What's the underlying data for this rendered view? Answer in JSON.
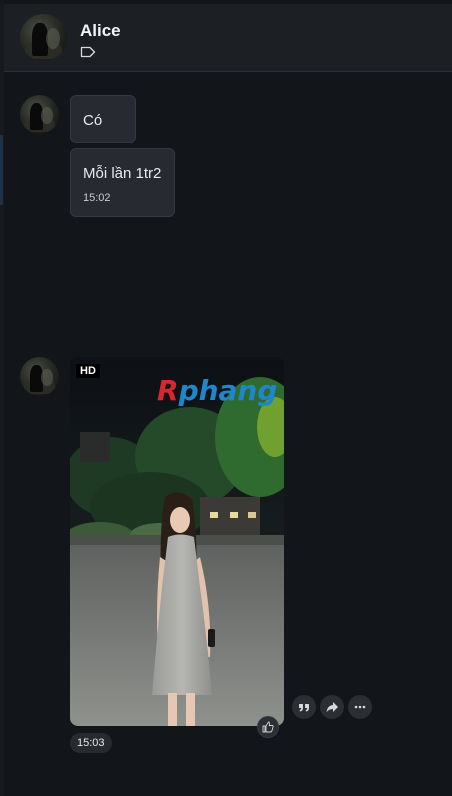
{
  "header": {
    "contact_name": "Alice",
    "tag_icon": "tag-icon"
  },
  "messages": [
    {
      "text": "Có"
    },
    {
      "text": "Mỗi lần 1tr2",
      "time": "15:02"
    }
  ],
  "photo_message": {
    "badge": "HD",
    "watermark_first": "R",
    "watermark_rest": "phang",
    "time": "15:03",
    "actions": [
      "quote-icon",
      "forward-icon",
      "more-icon"
    ],
    "reaction_icon": "thumbs-up-icon"
  },
  "colors": {
    "background": "#121519",
    "header": "#1c1f24",
    "bubble": "#272b31",
    "watermark_red": "#d8282f",
    "watermark_blue": "#1f86c9"
  }
}
